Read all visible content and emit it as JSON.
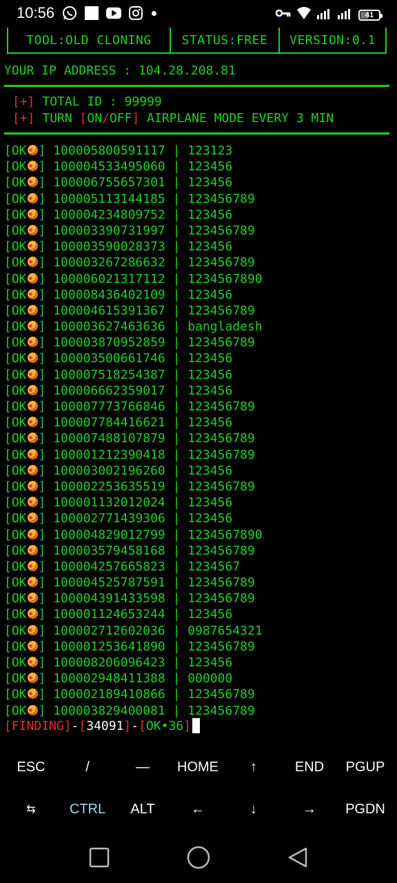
{
  "status_bar": {
    "time": "10:56",
    "battery": "41",
    "battery_level": 0.41,
    "left_icons": [
      "whatsapp-icon",
      "square-notification-icon",
      "youtube-icon",
      "instagram-icon",
      "dot-icon"
    ],
    "right_icons": [
      "key-icon",
      "wifi-icon",
      "signal-icon",
      "signal-icon",
      "battery-icon"
    ]
  },
  "header": {
    "tool": "TOOL:OLD CLONING",
    "status": "STATUS:FREE",
    "version": "VERSION:0.1",
    "ip": "YOUR IP ADDRESS : 104.28.208.81"
  },
  "info": {
    "bullet": "[+]",
    "total_id": "TOTAL ID : 99999",
    "turn": "TURN ",
    "on_off_open": "[",
    "on": "ON",
    "slash": "/",
    "off": "OFF",
    "on_off_close": "]",
    "airplane": " AIRPLANE MODE EVERY 3 MIN"
  },
  "results": [
    {
      "id": "100005800591117",
      "pass": "123123"
    },
    {
      "id": "100004533495060",
      "pass": "123456"
    },
    {
      "id": "100006755657301",
      "pass": "123456"
    },
    {
      "id": "100005113144185",
      "pass": "123456789"
    },
    {
      "id": "100004234809752",
      "pass": "123456"
    },
    {
      "id": "100003390731997",
      "pass": "123456789"
    },
    {
      "id": "100003590028373",
      "pass": "123456"
    },
    {
      "id": "100003267286632",
      "pass": "123456789"
    },
    {
      "id": "100006021317112",
      "pass": "1234567890"
    },
    {
      "id": "100008436402109",
      "pass": "123456"
    },
    {
      "id": "100004615391367",
      "pass": "123456789"
    },
    {
      "id": "100003627463636",
      "pass": "bangladesh"
    },
    {
      "id": "100003870952859",
      "pass": "123456789"
    },
    {
      "id": "100003500661746",
      "pass": "123456"
    },
    {
      "id": "100007518254387",
      "pass": "123456"
    },
    {
      "id": "100006662359017",
      "pass": "123456"
    },
    {
      "id": "100007773766846",
      "pass": "123456789"
    },
    {
      "id": "100007784416621",
      "pass": "123456"
    },
    {
      "id": "100007488107879",
      "pass": "123456789"
    },
    {
      "id": "100001212390418",
      "pass": "123456789"
    },
    {
      "id": "100003002196260",
      "pass": "123456"
    },
    {
      "id": "100002253635519",
      "pass": "123456789"
    },
    {
      "id": "100001132012024",
      "pass": "123456"
    },
    {
      "id": "100002771439306",
      "pass": "123456"
    },
    {
      "id": "100004829012799",
      "pass": "1234567890"
    },
    {
      "id": "100003579458168",
      "pass": "123456789"
    },
    {
      "id": "100004257665823",
      "pass": "1234567"
    },
    {
      "id": "100004525787591",
      "pass": "123456789"
    },
    {
      "id": "100004391433598",
      "pass": "123456789"
    },
    {
      "id": "100001124653244",
      "pass": "123456"
    },
    {
      "id": "100002712602036",
      "pass": "0987654321"
    },
    {
      "id": "100001253641890",
      "pass": "123456789"
    },
    {
      "id": "100008206096423",
      "pass": "123456"
    },
    {
      "id": "100002948411388",
      "pass": "000000"
    },
    {
      "id": "100002189410866",
      "pass": "123456789"
    },
    {
      "id": "100003829400081",
      "pass": "123456789"
    }
  ],
  "result_labels": {
    "open": "[",
    "ok": "OK",
    "close": "]",
    "sep": " | "
  },
  "finding": {
    "label": "FINDING",
    "count": "34091",
    "ok": "OK•36",
    "open": "[",
    "close": "]",
    "dash": "-"
  },
  "extra_keys": {
    "row1": [
      "ESC",
      "/",
      "—",
      "HOME",
      "↑",
      "END",
      "PGUP"
    ],
    "row2": [
      "⇆",
      "CTRL",
      "ALT",
      "←",
      "↓",
      "→",
      "PGDN"
    ]
  },
  "nav_bar": [
    "recents-icon",
    "home-icon",
    "back-icon"
  ],
  "colors": {
    "terminal_green": "#1ed31e",
    "red": "#e03030",
    "ctrl_blue": "#9fd9f0"
  }
}
